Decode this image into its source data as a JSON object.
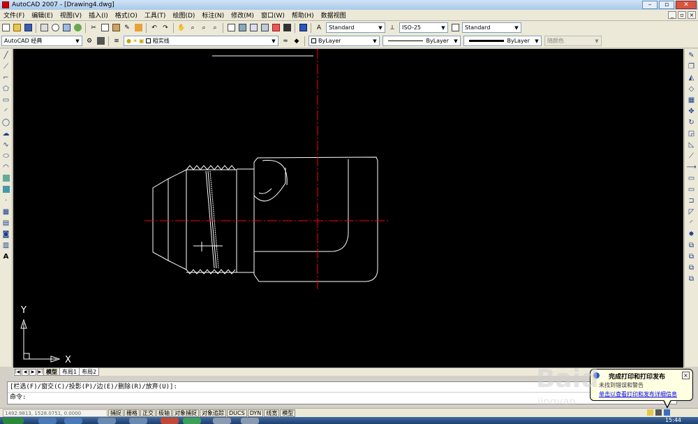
{
  "window": {
    "title": "AutoCAD 2007 - [Drawing4.dwg]"
  },
  "menu": [
    "文件(F)",
    "编辑(E)",
    "视图(V)",
    "插入(I)",
    "格式(O)",
    "工具(T)",
    "绘图(D)",
    "标注(N)",
    "修改(M)",
    "窗口(W)",
    "帮助(H)",
    "数据视图"
  ],
  "toolbar": {
    "text_style": "Standard",
    "dim_style": "ISO-25",
    "table_style": "Standard",
    "workspace": "AutoCAD 经典",
    "layer": "粗实线",
    "color": "ByLayer",
    "linetype": "ByLayer",
    "lineweight": "ByLayer",
    "plot_style": "随颜色"
  },
  "canvas": {
    "ucs_y": "Y",
    "ucs_x": "X",
    "background": "#000000",
    "line_color": "#ffffff",
    "center_line_color": "#ff0000"
  },
  "layout_tabs": [
    "模型",
    "布局1",
    "布局2"
  ],
  "command_line": {
    "history": "[栏选(F)/窗交(C)/投影(P)/边(E)/删除(R)/放弃(U)]:",
    "prompt": "命令:"
  },
  "status": {
    "coords": "1492.9813, 1528.0751, 0.0000",
    "buttons": [
      "捕捉",
      "栅格",
      "正交",
      "极轴",
      "对象捕捉",
      "对象追踪",
      "DUCS",
      "DYN",
      "线宽",
      "模型"
    ]
  },
  "balloon": {
    "title": "完成打印和打印发布",
    "subtitle": "未找到错误和警告",
    "link": "单击以查看打印和发布详细信息"
  },
  "taskbar": {
    "clock": "15:44"
  },
  "watermark": {
    "text": "Baid",
    "sub": "jingyan"
  }
}
